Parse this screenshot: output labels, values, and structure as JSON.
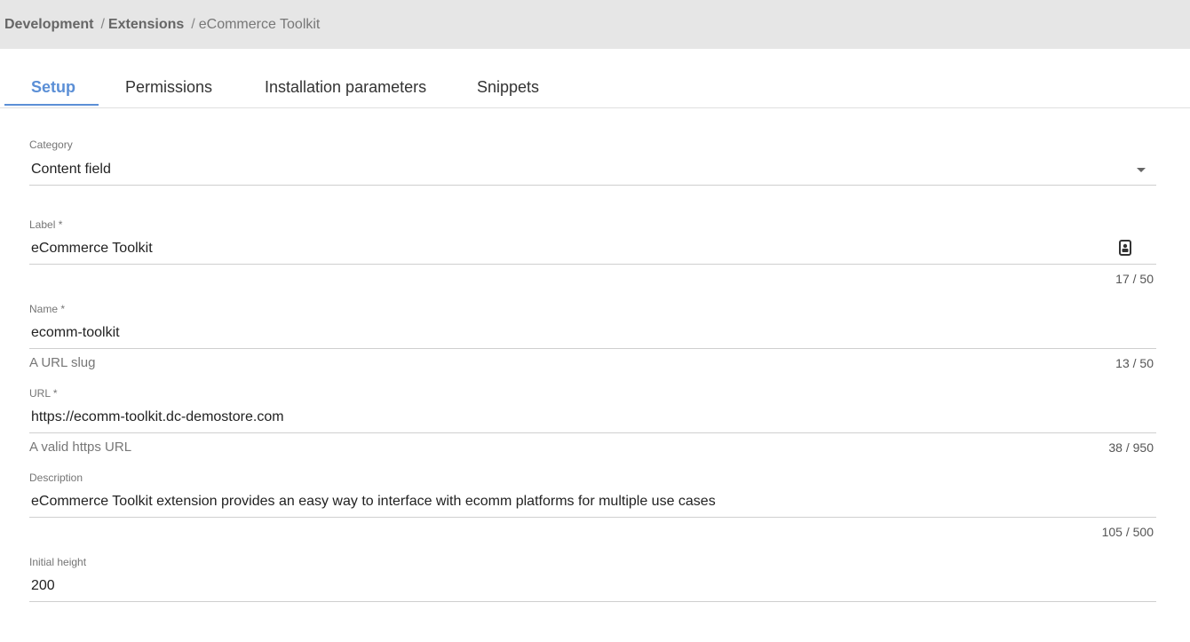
{
  "breadcrumb": {
    "items": [
      "Development",
      "Extensions"
    ],
    "separator": "/",
    "current": "eCommerce Toolkit"
  },
  "tabs": [
    {
      "label": "Setup",
      "active": true
    },
    {
      "label": "Permissions",
      "active": false
    },
    {
      "label": "Installation parameters",
      "active": false
    },
    {
      "label": "Snippets",
      "active": false
    }
  ],
  "form": {
    "category": {
      "label": "Category",
      "value": "Content field",
      "icon": "dropdown-arrow-icon"
    },
    "label_field": {
      "label": "Label *",
      "value": "eCommerce Toolkit",
      "counter": "17 / 50",
      "icon": "contact-card-icon"
    },
    "name_field": {
      "label": "Name *",
      "value": "ecomm-toolkit",
      "helper": "A URL slug",
      "counter": "13 / 50"
    },
    "url_field": {
      "label": "URL *",
      "value": "https://ecomm-toolkit.dc-demostore.com",
      "helper": "A valid https URL",
      "counter": "38 / 950"
    },
    "description_field": {
      "label": "Description",
      "value": "eCommerce Toolkit extension provides an easy way to interface with ecomm platforms for multiple use cases",
      "counter": "105 / 500"
    },
    "initial_height": {
      "label": "Initial height",
      "value": "200"
    }
  },
  "colors": {
    "accent": "#5b8fd6",
    "topbar": "#e6e6e6"
  }
}
